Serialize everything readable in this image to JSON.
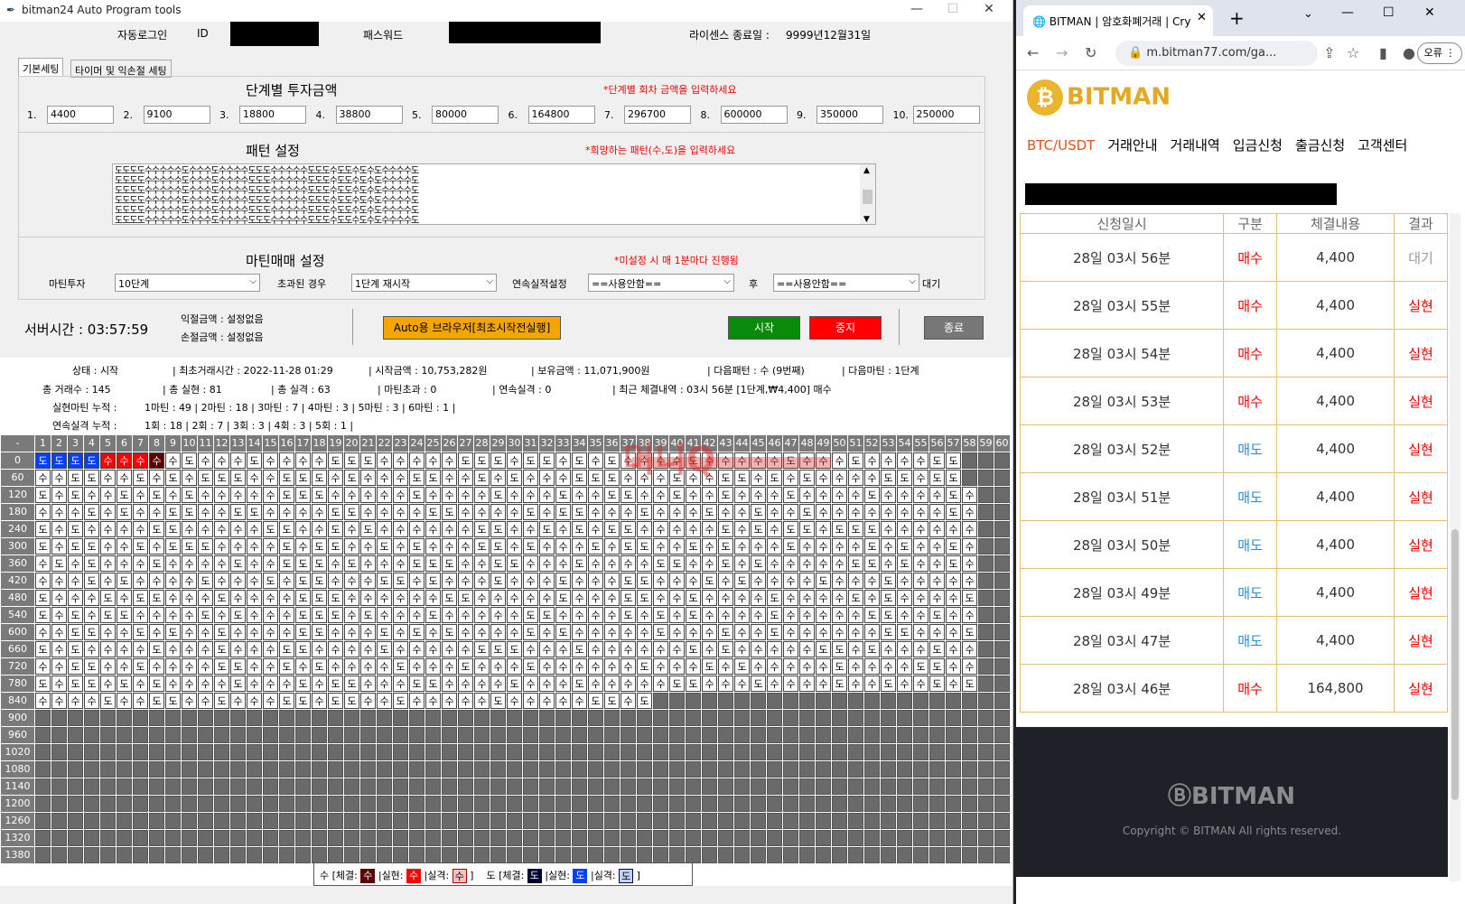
{
  "app": {
    "title": "bitman24 Auto Program tools",
    "autologin_label": "자동로그인",
    "id_label": "ID",
    "pw_label": "패스워드",
    "license_label": "라이센스 종료일 :",
    "license_value": "9999년12월31일",
    "tabs": [
      "기본세팅",
      "타이머 및 익손절 세팅"
    ],
    "invest": {
      "title": "단계별 투자금액",
      "hint": "*단계별 회차 금액을 입력하세요",
      "steps": [
        {
          "n": "1.",
          "v": "4400"
        },
        {
          "n": "2.",
          "v": "9100"
        },
        {
          "n": "3.",
          "v": "18800"
        },
        {
          "n": "4.",
          "v": "38800"
        },
        {
          "n": "5.",
          "v": "80000"
        },
        {
          "n": "6.",
          "v": "164800"
        },
        {
          "n": "7.",
          "v": "296700"
        },
        {
          "n": "8.",
          "v": "600000"
        },
        {
          "n": "9.",
          "v": "350000"
        },
        {
          "n": "10.",
          "v": "250000"
        }
      ]
    },
    "pattern": {
      "title": "패턴 설정",
      "hint": "*희망하는 패턴(수,도)을 입력하세요",
      "lines": [
        "도도도도수수수수수도수수수도수수수수도도도수수수수수도도도수도도수도수도수수수수도",
        "도도도도수수수수수도수수수도수수수수도도도수수수수수도도도수도도수도수도수수수수도",
        "도도도도수수수수수도수수수도수수수수도도도수수수수수도도도수도도수도수도수수수수도",
        "도도도도수수수수수도수수수도수수수수도도도수수수수수도도도수도도수도수도수수수수도",
        "도도도도수수수수수도수수수도수수수수도도도수수수수수도도도수도도수도수도수수수수도",
        "도도도도수수수수수도수수수도수수수수도도도수수수수수도도도수도도수도수도수수수수도"
      ]
    },
    "martin": {
      "title": "마틴매매 설정",
      "hint": "*미설정 시 매 1분마다 진행됨",
      "invest_label": "마틴투자",
      "invest_value": "10단계",
      "exceed_label": "초과된 경우",
      "exceed_value": "1단계 재시작",
      "cont_label": "연속실적설정",
      "cont_value": "==사용안함==",
      "after_label": "후",
      "after_value": "==사용안함==",
      "wait_label": "대기"
    },
    "server_time": "서버시간 : 03:57:59",
    "take_profit": "익절금액 :  설정없음",
    "stop_loss": "손절금액 :  설정없음",
    "browser_button": "Auto용 브라우저[최초시작전실행]",
    "start_button": "시작",
    "stop_button": "중지",
    "exit_button": "종료",
    "stats": {
      "status": "상태 : 시작",
      "first_trade": "| 최초거래시간 : 2022-11-28 01:29",
      "start_amount": "| 시작금액 :    10,753,282원",
      "hold_amount": "| 보유금액 :    11,071,900원",
      "next_pattern": "| 다음패턴 :  수 (9번째)",
      "next_martin": "| 다음마틴 :  1단계",
      "total_trades": "총 거래수 :  145",
      "total_wins": "| 총 실현 :  81",
      "total_losses": "| 총 실격 :  63",
      "martin_exceed": "| 마틴초과 : 0",
      "cont_losses": "| 연속실격 : 0",
      "recent": "| 최근 체결내역 :    03시 56분 [1단계,₩4,400] 매수",
      "win_martin": "실현마틴 누적 :",
      "win_martin_v": "1마틴 : 49 | 2마틴 : 18 | 3마틴 : 7 | 4마틴 : 3 | 5마틴 : 3 | 6마틴 : 1 |",
      "loss_cont": "연속실격 누적 :",
      "loss_cont_v": "1회 : 18 | 2회 : 7 | 3회 : 3 | 4회 : 3 | 5회 : 1 |"
    },
    "grid": {
      "corner": "-",
      "row_labels": [
        "0",
        "60",
        "120",
        "180",
        "240",
        "300",
        "360",
        "420",
        "480",
        "540",
        "600",
        "660",
        "720",
        "780",
        "840",
        "900",
        "960",
        "1020",
        "1080",
        "1140",
        "1200",
        "1260",
        "1320",
        "1380"
      ],
      "rows": [
        "도도도도수수수수수도수수수도수수수수도도도수수수수수도도도수도도수도수도수수수수도수수수수수도수수수도수수수수도도",
        "수수도도수수도수도수도도도수수도도도수도수수수도도수수도수도수수수도도도수수수도수수도도수도수도수수수수도도수도도",
        "도수도수수도수도수도수수수수수도도도수수수수수도수수수수도수수수도수수도도수수도수수도수수수도수수수수도수수수수도수",
        "수수수도수도수수도도수수도도수수수수도도수수수수도도수수수수도수도도수수수도수수수도수수도수수도수수수수수수수수도수",
        "도수도수수수수도도수수수수수도도수수도수도수수수수수수도도수수도수도수도도수수수수수도수도수도도수도도도수수수수수수",
        "도수도도수수도수도도도수수수수도수도도수수도수도수수수도도수도수수수도수도도수수도수도수수수도수수수수도수도수수도수",
        "수도수도수수수도수수수수도수수도도도수도수수수도도도수수도도수수수도수수수수도도수수도수도수수수수수도도수도수수도수",
        "수수수도수도수수수수도수수수도수도도수수수도도수도수수수도수수수도수수수도도수수수도수도수수수수도수수수도수수수수수",
        "도수수수도수도도수수수도수수수수도도도수수수수수수도도수수수수수도수수수도도수수도수수수수도수수수수도수도수수수수도",
        "도수도수도도수수수수도수도수수수도도도수도수수수도수수수수수도도수수수수도수도수도수수수수도수수수수수도도수수도수수",
        "수수도도수수도수도수수도수수수수도도수수수도수도수도수수수수도수도수수수수수도수수수도수수도수수수수수수도도수수수도",
        "도수도수수수수도수수수도수수수도도수수수수도수수수수수도도도수수수도수수수수수수도수도수수수수수도도수도수수수도수수",
        "수수도도수수도수수수수도도수수도수도수수수수도수수수도수수수도수수수수수수도수수수도수도수수수수수도수수수수도도수수",
        "도수도도수도수도수수수수도수수수도수도도수수수도도수수수수도수수수도수수수수수도도수수수도수수수수도수수도수수도수도",
        "수수수수도수수도도수수도수수수도도수도도수수도수수수수수도수수수수수도도수도"
      ],
      "highlight_first_row": [
        "blue",
        "blue",
        "blue",
        "blue",
        "red",
        "red",
        "red",
        "darkred"
      ]
    },
    "legend": {
      "su_label": "수 [체결:",
      "su_exec": "수",
      "win_label": "|실현:",
      "su_win": "수",
      "loss_label": "|실격:",
      "su_loss": "수",
      "close": "]",
      "do_label": "도 [체결:",
      "do_exec": "도",
      "do_win": "도",
      "do_loss": "도"
    },
    "watermark": "머니Q"
  },
  "browser": {
    "tab_title": "BITMAN | 암호화폐거래 | Cry",
    "new_tab": "+",
    "url": "m.bitman77.com/ga...",
    "error_btn": "오류",
    "logo": "BITMAN",
    "nav": [
      "BTC/USDT",
      "거래안내",
      "거래내역",
      "입금신청",
      "출금신청",
      "고객센터"
    ],
    "table_header": [
      "신청일시",
      "구분",
      "체결내용",
      "결과"
    ],
    "rows": [
      {
        "time": "28일 03시 56분",
        "type": "매수",
        "amount": "4,400",
        "result": "대기"
      },
      {
        "time": "28일 03시 55분",
        "type": "매수",
        "amount": "4,400",
        "result": "실현"
      },
      {
        "time": "28일 03시 54분",
        "type": "매수",
        "amount": "4,400",
        "result": "실현"
      },
      {
        "time": "28일 03시 53분",
        "type": "매수",
        "amount": "4,400",
        "result": "실현"
      },
      {
        "time": "28일 03시 52분",
        "type": "매도",
        "amount": "4,400",
        "result": "실현"
      },
      {
        "time": "28일 03시 51분",
        "type": "매도",
        "amount": "4,400",
        "result": "실현"
      },
      {
        "time": "28일 03시 50분",
        "type": "매도",
        "amount": "4,400",
        "result": "실현"
      },
      {
        "time": "28일 03시 49분",
        "type": "매도",
        "amount": "4,400",
        "result": "실현"
      },
      {
        "time": "28일 03시 47분",
        "type": "매도",
        "amount": "4,400",
        "result": "실현"
      },
      {
        "time": "28일 03시 46분",
        "type": "매수",
        "amount": "164,800",
        "result": "실현"
      }
    ],
    "footer_logo": "BITMAN",
    "copyright": "Copyright © BITMAN All rights reserved."
  }
}
